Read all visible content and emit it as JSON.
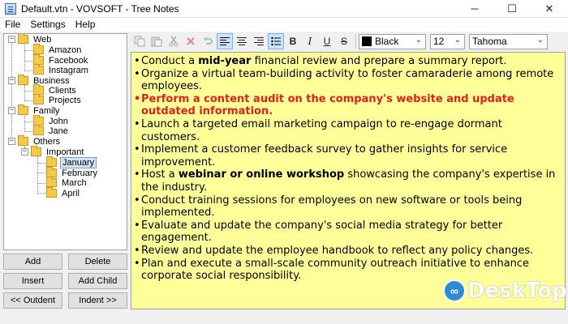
{
  "window": {
    "title": "Default.vtn - VOVSOFT - Tree Notes",
    "minimize": "─",
    "maximize": "☐",
    "close": "✕"
  },
  "menu": [
    "File",
    "Settings",
    "Help"
  ],
  "tree": {
    "web": "Web",
    "amazon": "Amazon",
    "facebook": "Facebook",
    "instagram": "Instagram",
    "business": "Business",
    "clients": "Clients",
    "projects": "Projects",
    "family": "Family",
    "john": "John",
    "jane": "Jane",
    "others": "Others",
    "important": "Important",
    "january": "January",
    "february": "February",
    "march": "March",
    "april": "April",
    "selected": "January"
  },
  "buttons": {
    "add": "Add",
    "delete": "Delete",
    "insert": "Insert",
    "add_child": "Add Child",
    "outdent": "<< Outdent",
    "indent": "Indent >>"
  },
  "toolbar": {
    "color": "Black",
    "font_size": "12",
    "font_name": "Tahoma",
    "colors": {
      "swatch": "#000000",
      "active": "#cce4f7"
    }
  },
  "editor": {
    "background": "#ffff99",
    "highlight_color": "#e0201a",
    "bullet": "•",
    "items": {
      "i1_a": "Conduct a ",
      "i1_b": "mid-year",
      "i1_c": " financial review and prepare a summary report.",
      "i2": "Organize a virtual team-building activity to foster camaraderie among remote employees.",
      "i3": "Perform a content audit on the company's website and update outdated information.",
      "i4": "Launch a targeted email marketing campaign to re-engage dormant customers.",
      "i5": "Implement a customer feedback survey to gather insights for service improvement.",
      "i6_a": "Host a ",
      "i6_b": "webinar or online workshop",
      "i6_c": " showcasing the company's expertise in the industry.",
      "i7": "Conduct training sessions for employees on new software or tools being implemented.",
      "i8": "Evaluate and update the company's social media strategy for better engagement.",
      "i9": "Review and update the employee handbook to reflect any policy changes.",
      "i10": "Plan and execute a small-scale community outreach initiative to enhance corporate social responsibility."
    }
  },
  "watermark": {
    "logo": "∞",
    "text": "DeskTop"
  }
}
